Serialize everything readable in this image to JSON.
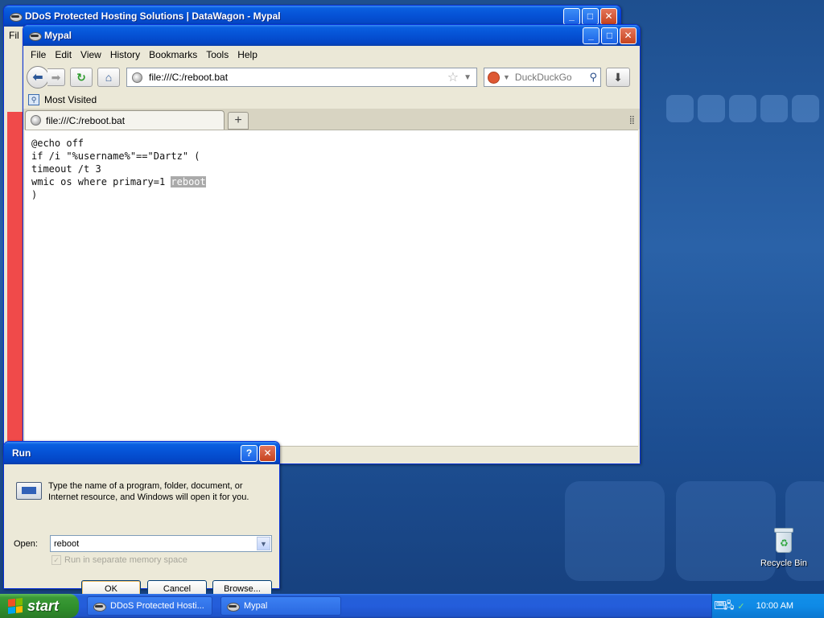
{
  "desktop": {
    "recycle_bin_label": "Recycle Bin"
  },
  "back_window": {
    "title": "DDoS Protected Hosting Solutions  | DataWagon - Mypal",
    "menu_fragment": "Fil"
  },
  "mypal": {
    "title": "Mypal",
    "menu": [
      "File",
      "Edit",
      "View",
      "History",
      "Bookmarks",
      "Tools",
      "Help"
    ],
    "url": "file:///C:/reboot.bat",
    "search_placeholder": "DuckDuckGo",
    "bookmarks_toolbar": {
      "most_visited": "Most Visited"
    },
    "tab_title": "file:///C:/reboot.bat",
    "file_lines": [
      "@echo off",
      "if /i \"%username%\"==\"Dartz\" (",
      "timeout /t 3",
      "wmic os where primary=1 ",
      ")"
    ],
    "highlighted_word": "reboot"
  },
  "run_dialog": {
    "title": "Run",
    "description": "Type the name of a program, folder, document, or Internet resource, and Windows will open it for you.",
    "open_label": "Open:",
    "open_value": "reboot",
    "checkbox_label": "Run in separate memory space",
    "buttons": {
      "ok": "OK",
      "cancel": "Cancel",
      "browse": "Browse..."
    }
  },
  "taskbar": {
    "start_label": "start",
    "items": [
      "DDoS Protected Hosti...",
      "Mypal"
    ],
    "clock": "10:00 AM"
  },
  "colors": {
    "xp_blue": "#0551d4",
    "start_green": "#2f8e2c",
    "selection": "#aaaaaa"
  }
}
